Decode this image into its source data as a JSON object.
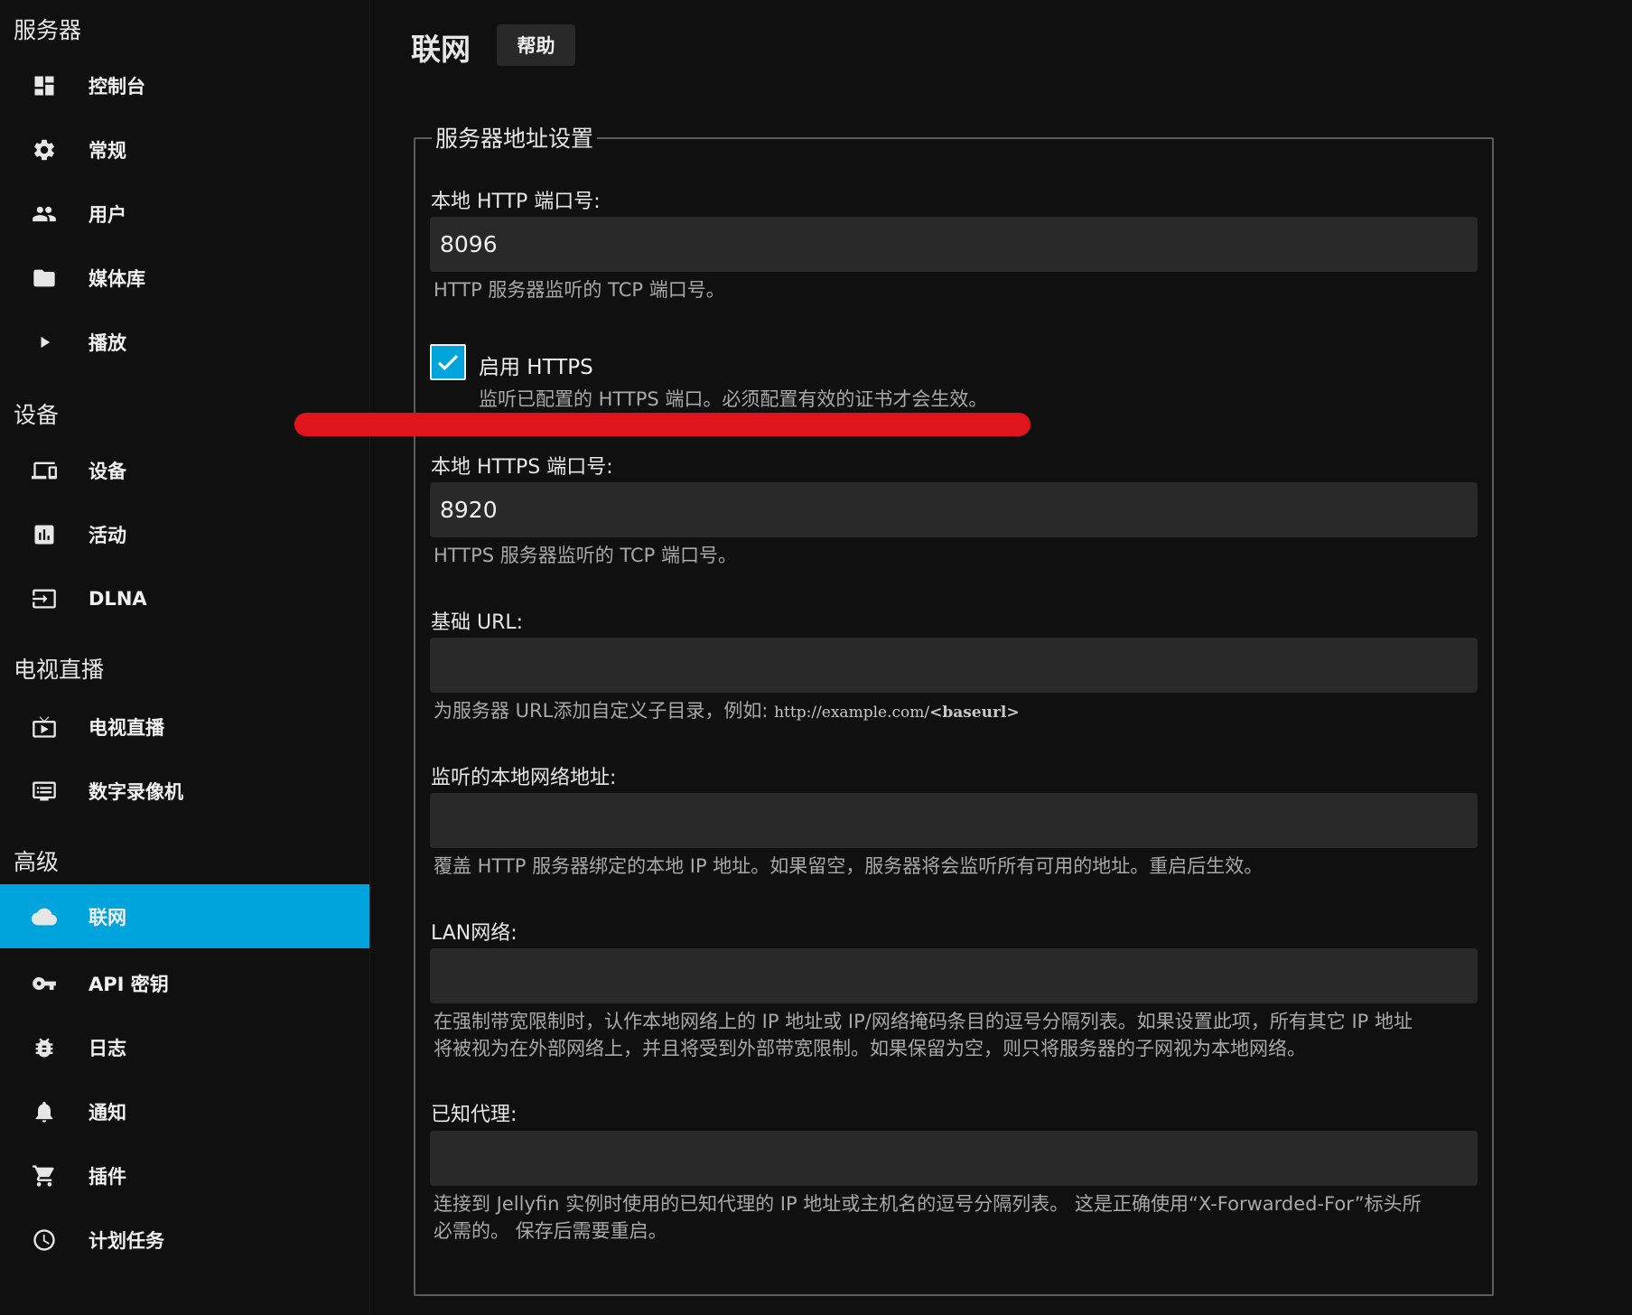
{
  "sidebar": {
    "sections": [
      {
        "title": "服务器",
        "items": [
          {
            "label": "控制台",
            "icon": "dashboard-icon"
          },
          {
            "label": "常规",
            "icon": "gear-icon"
          },
          {
            "label": "用户",
            "icon": "users-icon"
          },
          {
            "label": "媒体库",
            "icon": "folder-icon"
          },
          {
            "label": "播放",
            "icon": "play-icon"
          }
        ]
      },
      {
        "title": "设备",
        "items": [
          {
            "label": "设备",
            "icon": "devices-icon"
          },
          {
            "label": "活动",
            "icon": "activity-icon"
          },
          {
            "label": "DLNA",
            "icon": "input-icon"
          }
        ]
      },
      {
        "title": "电视直播",
        "items": [
          {
            "label": "电视直播",
            "icon": "live-tv-icon"
          },
          {
            "label": "数字录像机",
            "icon": "dvr-icon"
          }
        ]
      },
      {
        "title": "高级",
        "items": [
          {
            "label": "联网",
            "icon": "cloud-icon",
            "active": true
          },
          {
            "label": "API 密钥",
            "icon": "key-icon"
          },
          {
            "label": "日志",
            "icon": "bug-icon"
          },
          {
            "label": "通知",
            "icon": "bell-icon"
          },
          {
            "label": "插件",
            "icon": "cart-icon"
          },
          {
            "label": "计划任务",
            "icon": "clock-icon"
          }
        ]
      }
    ]
  },
  "header": {
    "title": "联网",
    "help_label": "帮助"
  },
  "form": {
    "legend": "服务器地址设置",
    "http_port": {
      "label": "本地 HTTP 端口号:",
      "value": "8096",
      "description": "HTTP 服务器监听的 TCP 端口号。"
    },
    "https_enable": {
      "label": "启用 HTTPS",
      "checked": true,
      "description": "监听已配置的 HTTPS 端口。必须配置有效的证书才会生效。"
    },
    "https_port": {
      "label": "本地 HTTPS 端口号:",
      "value": "8920",
      "description": "HTTPS 服务器监听的 TCP 端口号。"
    },
    "base_url": {
      "label": "基础 URL:",
      "value": "",
      "description": "为服务器 URL添加自定义子目录，例如:",
      "example": "http://example.com/",
      "example_bold": "<baseurl>"
    },
    "bind_address": {
      "label": "监听的本地网络地址:",
      "value": "",
      "description": "覆盖 HTTP 服务器绑定的本地 IP 地址。如果留空，服务器将会监听所有可用的地址。重启后生效。"
    },
    "lan_networks": {
      "label": "LAN网络:",
      "value": "",
      "description_line1": "在强制带宽限制时，认作本地网络上的 IP 地址或 IP/网络掩码条目的逗号分隔列表。如果设置此项，所有其它 IP 地址",
      "description_line2": "将被视为在外部网络上，并且将受到外部带宽限制。如果保留为空，则只将服务器的子网视为本地网络。"
    },
    "known_proxies": {
      "label": "已知代理:",
      "value": "",
      "description_line1": "连接到 Jellyfin 实例时使用的已知代理的 IP 地址或主机名的逗号分隔列表。 这是正确使用“X-Forwarded-For”标头所",
      "description_line2": "必需的。 保存后需要重启。"
    }
  },
  "colors": {
    "accent": "#00a4dc",
    "annotation": "#e0141c",
    "background": "#101010",
    "input_bg": "#292929"
  }
}
